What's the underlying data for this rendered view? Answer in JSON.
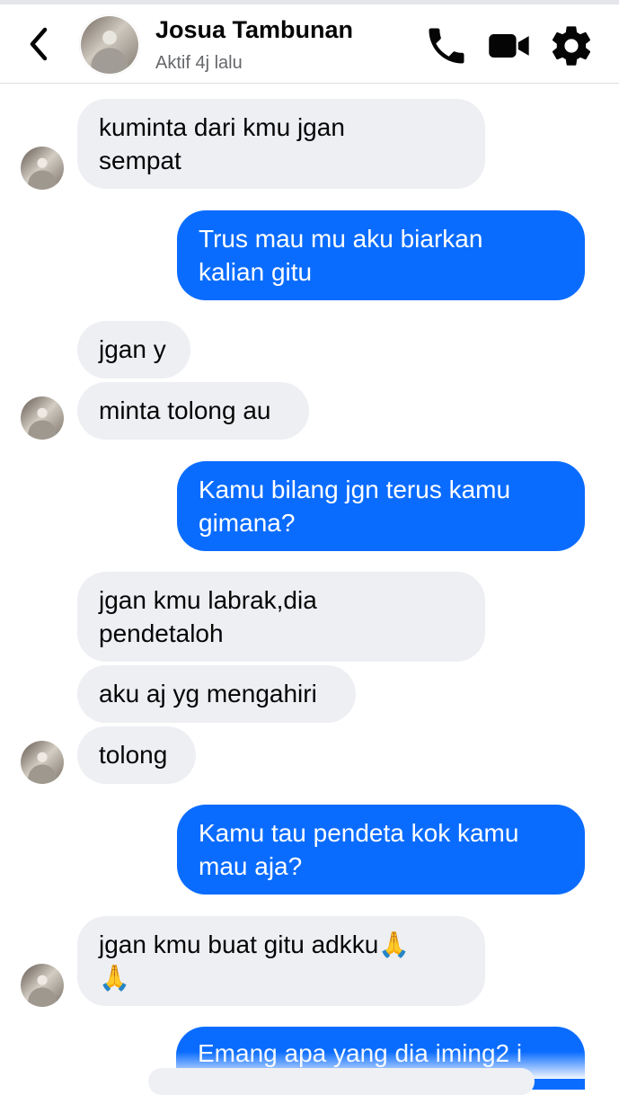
{
  "header": {
    "name": "Josua Tambunan",
    "status": "Aktif 4j lalu"
  },
  "messages": [
    {
      "from": "contact",
      "text": "kuminta dari kmu jgan\nsempat"
    },
    {
      "from": "me",
      "text": "Trus mau mu aku biarkan\nkalian gitu"
    },
    {
      "from": "contact",
      "text": "jgan y"
    },
    {
      "from": "contact",
      "text": "minta tolong au"
    },
    {
      "from": "me",
      "text": "Kamu bilang jgn terus kamu\ngimana?"
    },
    {
      "from": "contact",
      "text": "jgan kmu labrak,dia\npendetaloh"
    },
    {
      "from": "contact",
      "text": "aku aj yg mengahiri"
    },
    {
      "from": "contact",
      "text": "tolong"
    },
    {
      "from": "me",
      "text": "Kamu tau pendeta kok kamu\nmau aja?"
    },
    {
      "from": "contact",
      "text": "jgan kmu buat gitu adkku🙏\n🙏"
    },
    {
      "from": "me",
      "text": "Emang apa yang dia iming2 i"
    }
  ],
  "icons": {
    "back": "chevron-left-icon",
    "call": "phone-icon",
    "video": "video-camera-icon",
    "settings": "gear-icon"
  },
  "colors": {
    "outgoing": "#0a6cff",
    "incoming": "#eeeff3",
    "status": "#65676b"
  }
}
